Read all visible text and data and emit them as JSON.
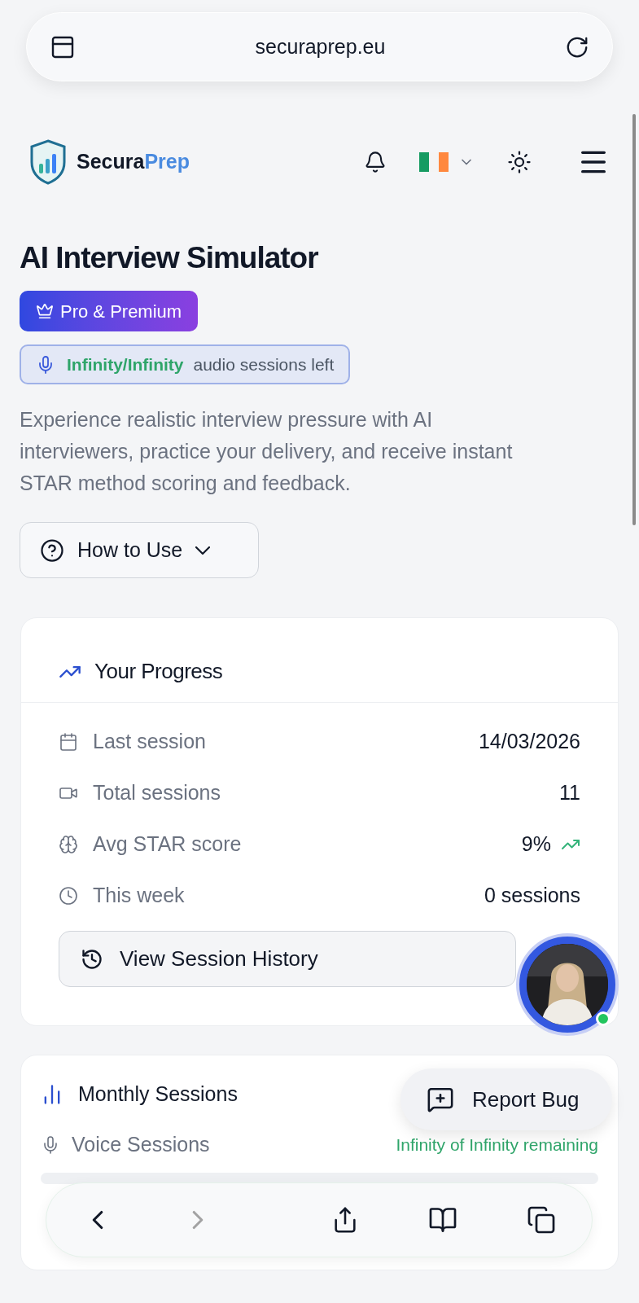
{
  "browser": {
    "url": "securaprep.eu"
  },
  "brand": {
    "primary": "Secura",
    "accent": "Prep"
  },
  "page": {
    "title": "AI Interview Simulator",
    "plan_badge": "Pro & Premium",
    "sessions_pill": {
      "count": "Infinity/Infinity",
      "label": "audio sessions left"
    },
    "description": "Experience realistic interview pressure with AI interviewers, practice your delivery, and receive instant STAR method scoring and feedback.",
    "how_to_use": "How to Use"
  },
  "progress": {
    "title": "Your Progress",
    "rows": [
      {
        "kind": "calendar",
        "label": "Last session",
        "value": "14/03/2026",
        "trend": false
      },
      {
        "kind": "video",
        "label": "Total sessions",
        "value": "11",
        "trend": false
      },
      {
        "kind": "brain",
        "label": "Avg STAR score",
        "value": "9%",
        "trend": true
      },
      {
        "kind": "clock",
        "label": "This week",
        "value": "0 sessions",
        "trend": false
      }
    ],
    "history_button": "View Session History"
  },
  "assistant": {
    "online": true
  },
  "monthly": {
    "title": "Monthly Sessions",
    "rows": [
      {
        "label": "Voice Sessions",
        "remaining": "Infinity of Infinity remaining"
      }
    ]
  },
  "report_bug": "Report Bug"
}
